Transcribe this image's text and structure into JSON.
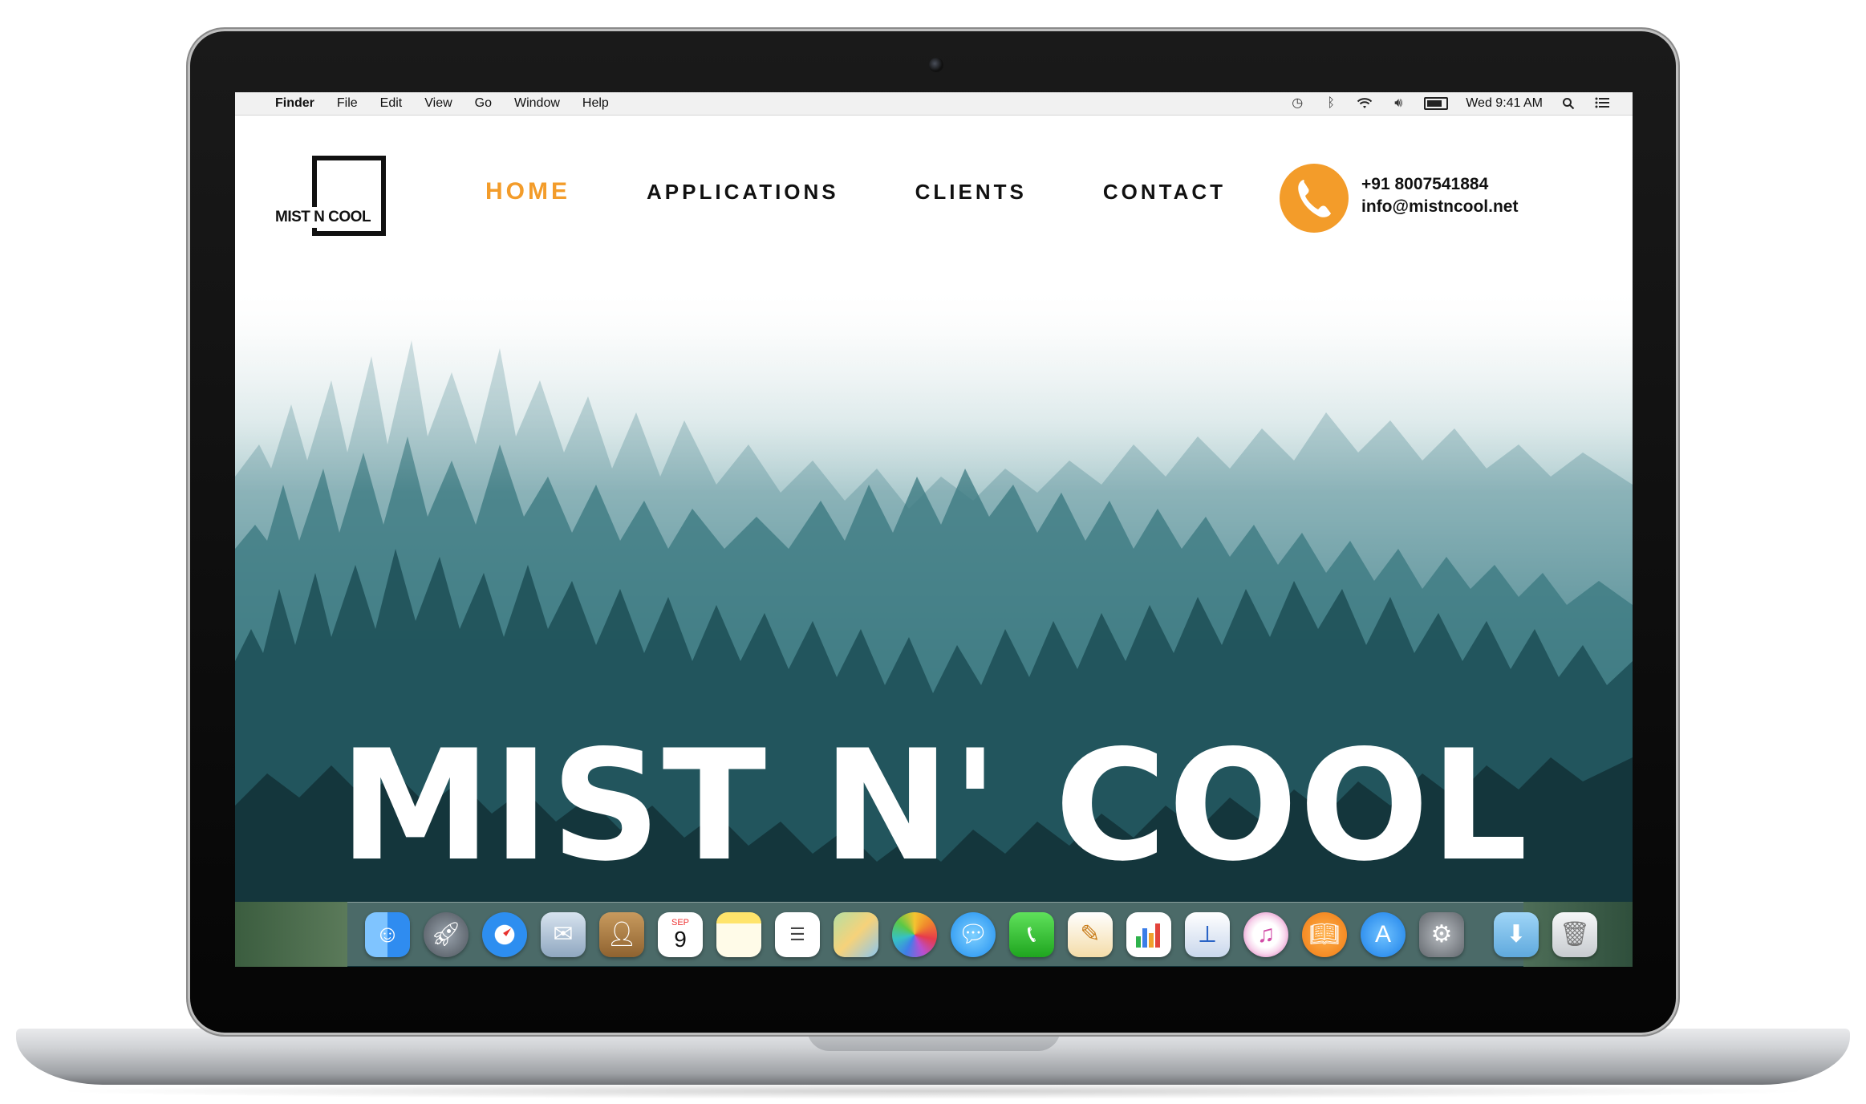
{
  "menubar": {
    "apple": "",
    "app_name": "Finder",
    "items": [
      "File",
      "Edit",
      "View",
      "Go",
      "Window",
      "Help"
    ],
    "clock": "Wed 9:41 AM"
  },
  "site": {
    "logo_text": "MIST N COOL",
    "nav": [
      "HOME",
      "APPLICATIONS",
      "CLIENTS",
      "CONTACT"
    ],
    "active_nav_color": "#f39c2a",
    "phone": "+91 8007541884",
    "email": "info@mistncool.net",
    "hero_title": "MIST N' COOL"
  },
  "dock": {
    "apps": [
      "finder-icon",
      "launchpad-icon",
      "safari-icon",
      "mail-icon",
      "contacts-icon",
      "calendar-icon",
      "notes-icon",
      "reminders-icon",
      "maps-icon",
      "photos-icon",
      "messages-icon",
      "facetime-icon",
      "pages-icon",
      "numbers-icon",
      "keynote-icon",
      "itunes-icon",
      "ibooks-icon",
      "app-store-icon",
      "system-preferences-icon",
      "downloads-icon",
      "trash-icon"
    ],
    "calendar_month": "SEP",
    "calendar_day": "9"
  }
}
